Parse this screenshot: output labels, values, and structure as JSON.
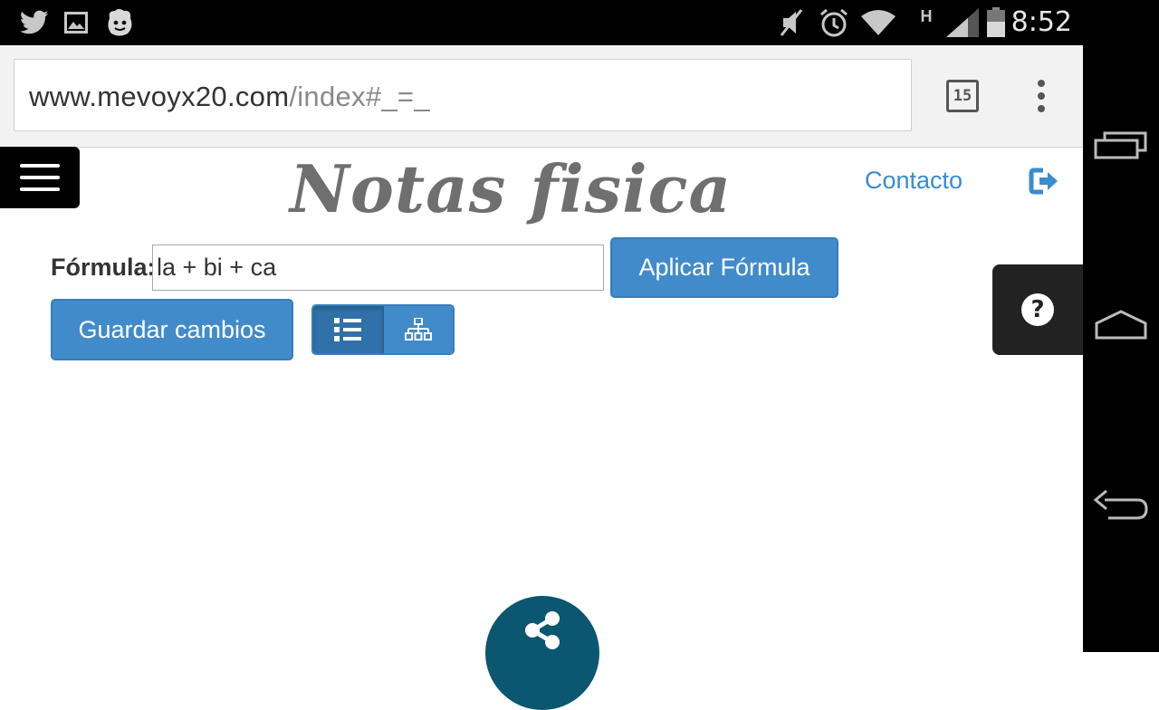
{
  "status_bar": {
    "time": "8:52",
    "network_type": "H",
    "icons": [
      "twitter-icon",
      "image-icon",
      "face-app-icon",
      "mute-icon",
      "alarm-icon",
      "wifi-icon",
      "signal-icon",
      "battery-icon"
    ]
  },
  "browser": {
    "url_domain": "www.mevoyx20.com",
    "url_path": "/index#_=_",
    "tab_count": "15",
    "menu_icon": "overflow-menu-icon"
  },
  "page": {
    "title": "Notas fisica",
    "contact_link": "Contacto",
    "formula_label": "Fórmula:",
    "formula_value": "la + bi + ca",
    "apply_button": "Aplicar Fórmula",
    "save_button": "Guardar cambios",
    "view_toggle": [
      "list-view-icon",
      "tree-view-icon"
    ],
    "help_symbol": "?"
  },
  "colors": {
    "primary": "#428bca",
    "link": "#3a8bd0",
    "share_fab": "#0b5670"
  }
}
